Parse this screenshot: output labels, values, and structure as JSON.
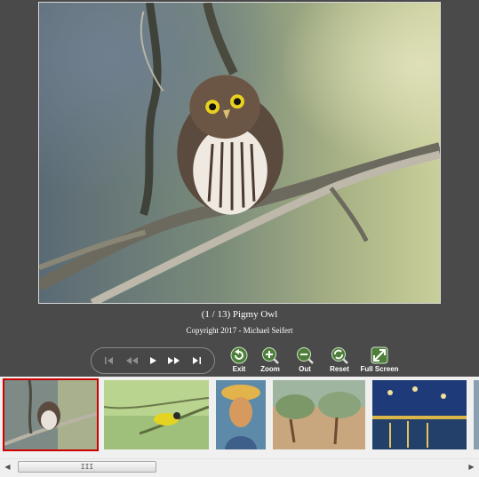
{
  "caption": {
    "title": "(1 / 13)  Pigmy Owl",
    "copyright": "Copyright 2017 - Michael Seifert"
  },
  "player": {
    "buttons": [
      {
        "name": "first-icon",
        "enabled": false
      },
      {
        "name": "rewind-icon",
        "enabled": false
      },
      {
        "name": "play-icon",
        "enabled": true
      },
      {
        "name": "fast-forward-icon",
        "enabled": true
      },
      {
        "name": "last-icon",
        "enabled": true
      }
    ]
  },
  "toolbar": {
    "exit_label": "Exit",
    "zoom_in_label": "Zoom",
    "zoom_out_label": "Out",
    "reset_label": "Reset",
    "fullscreen_label": "Full Screen"
  },
  "filmstrip": {
    "items": [
      {
        "subject": "pigmy-owl",
        "selected": true
      },
      {
        "subject": "yellow-bird",
        "selected": false
      },
      {
        "subject": "van-gogh-self-portrait",
        "selected": false
      },
      {
        "subject": "olive-trees",
        "selected": false
      },
      {
        "subject": "starry-night-over-rhone",
        "selected": false
      },
      {
        "subject": "partial-thumbnail",
        "selected": false
      }
    ]
  },
  "scrollbar": {
    "grip_label": "III"
  },
  "colors": {
    "viewer_background": "#4a4a4a",
    "filmstrip_background": "#f0f0f0",
    "selected_outline": "#cc0000",
    "tool_icon_green": "#4d7f3a"
  }
}
